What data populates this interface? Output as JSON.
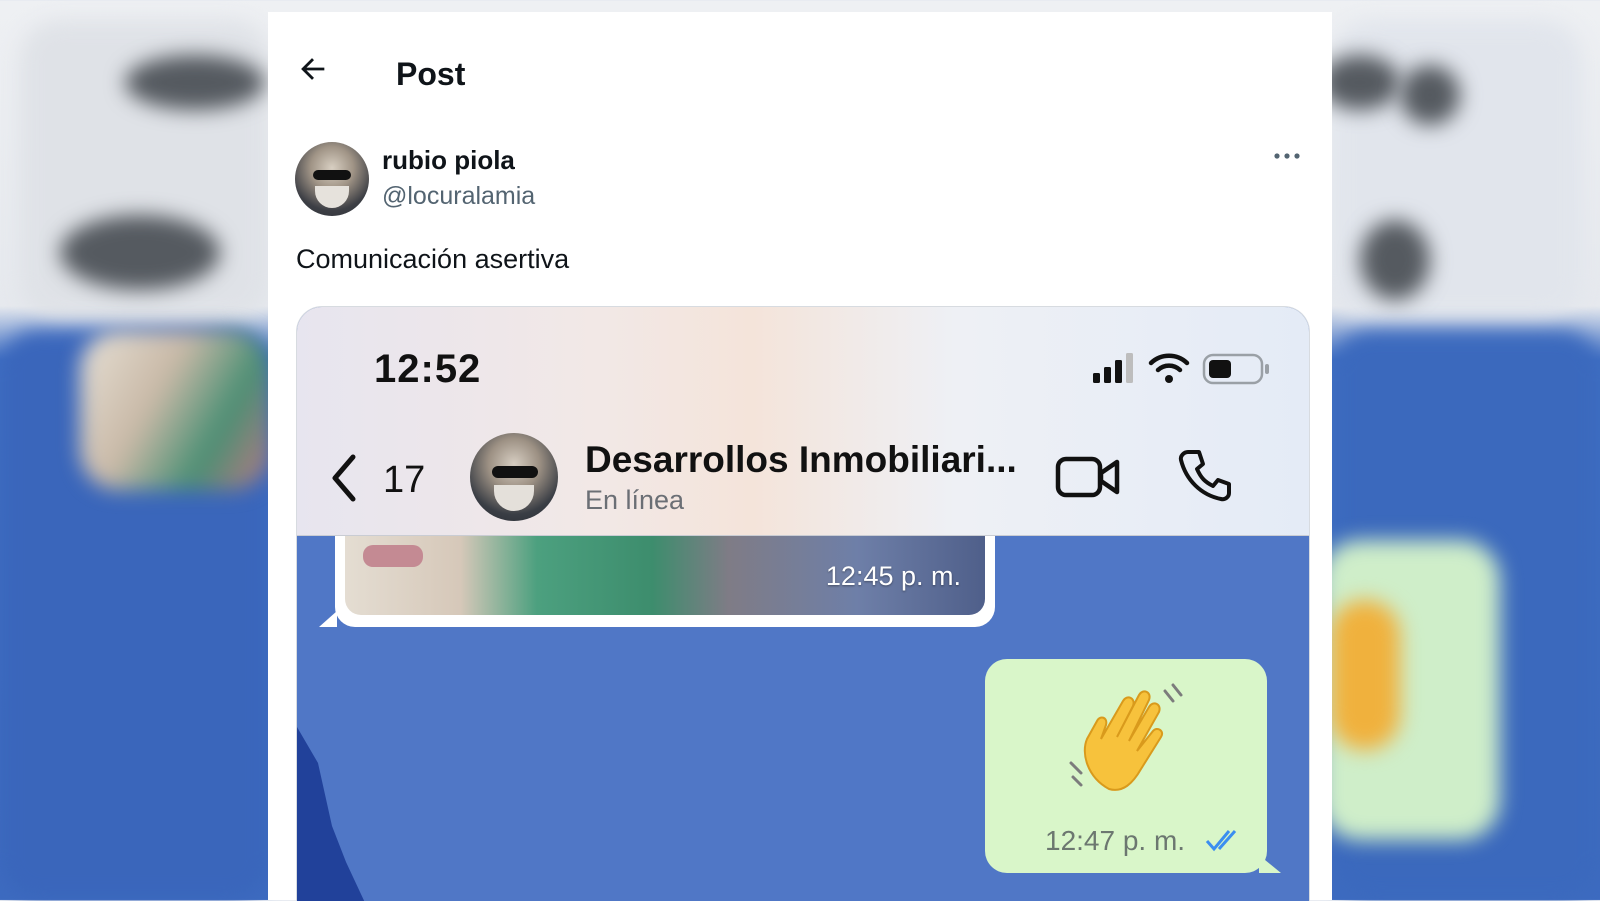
{
  "post_header": {
    "title": "Post"
  },
  "author": {
    "name": "rubio piola",
    "handle": "@locuralamia"
  },
  "post": {
    "text": "Comunicación asertiva"
  },
  "chat_screenshot": {
    "clock": "12:52",
    "unread_count": "17",
    "contact_name": "Desarrollos Inmobiliari...",
    "contact_status": "En línea",
    "messages": [
      {
        "type": "incoming-image",
        "time": "12:45 p. m."
      },
      {
        "type": "outgoing-emoji",
        "emoji": "waving-hand",
        "time": "12:47 p. m.",
        "status": "read"
      }
    ]
  },
  "icons": {
    "back": "arrow-left-icon",
    "more": "ellipsis-icon",
    "signal": "signal-bars-icon",
    "wifi": "wifi-icon",
    "battery": "battery-icon",
    "chat_back": "chevron-left-icon",
    "video": "video-camera-icon",
    "call": "phone-icon",
    "read": "double-check-icon"
  },
  "colors": {
    "chat_background": "#5077c6",
    "outgoing_bubble": "#d9f6c9",
    "read_ticks": "#3b8ef0",
    "handle_gray": "#536471"
  }
}
